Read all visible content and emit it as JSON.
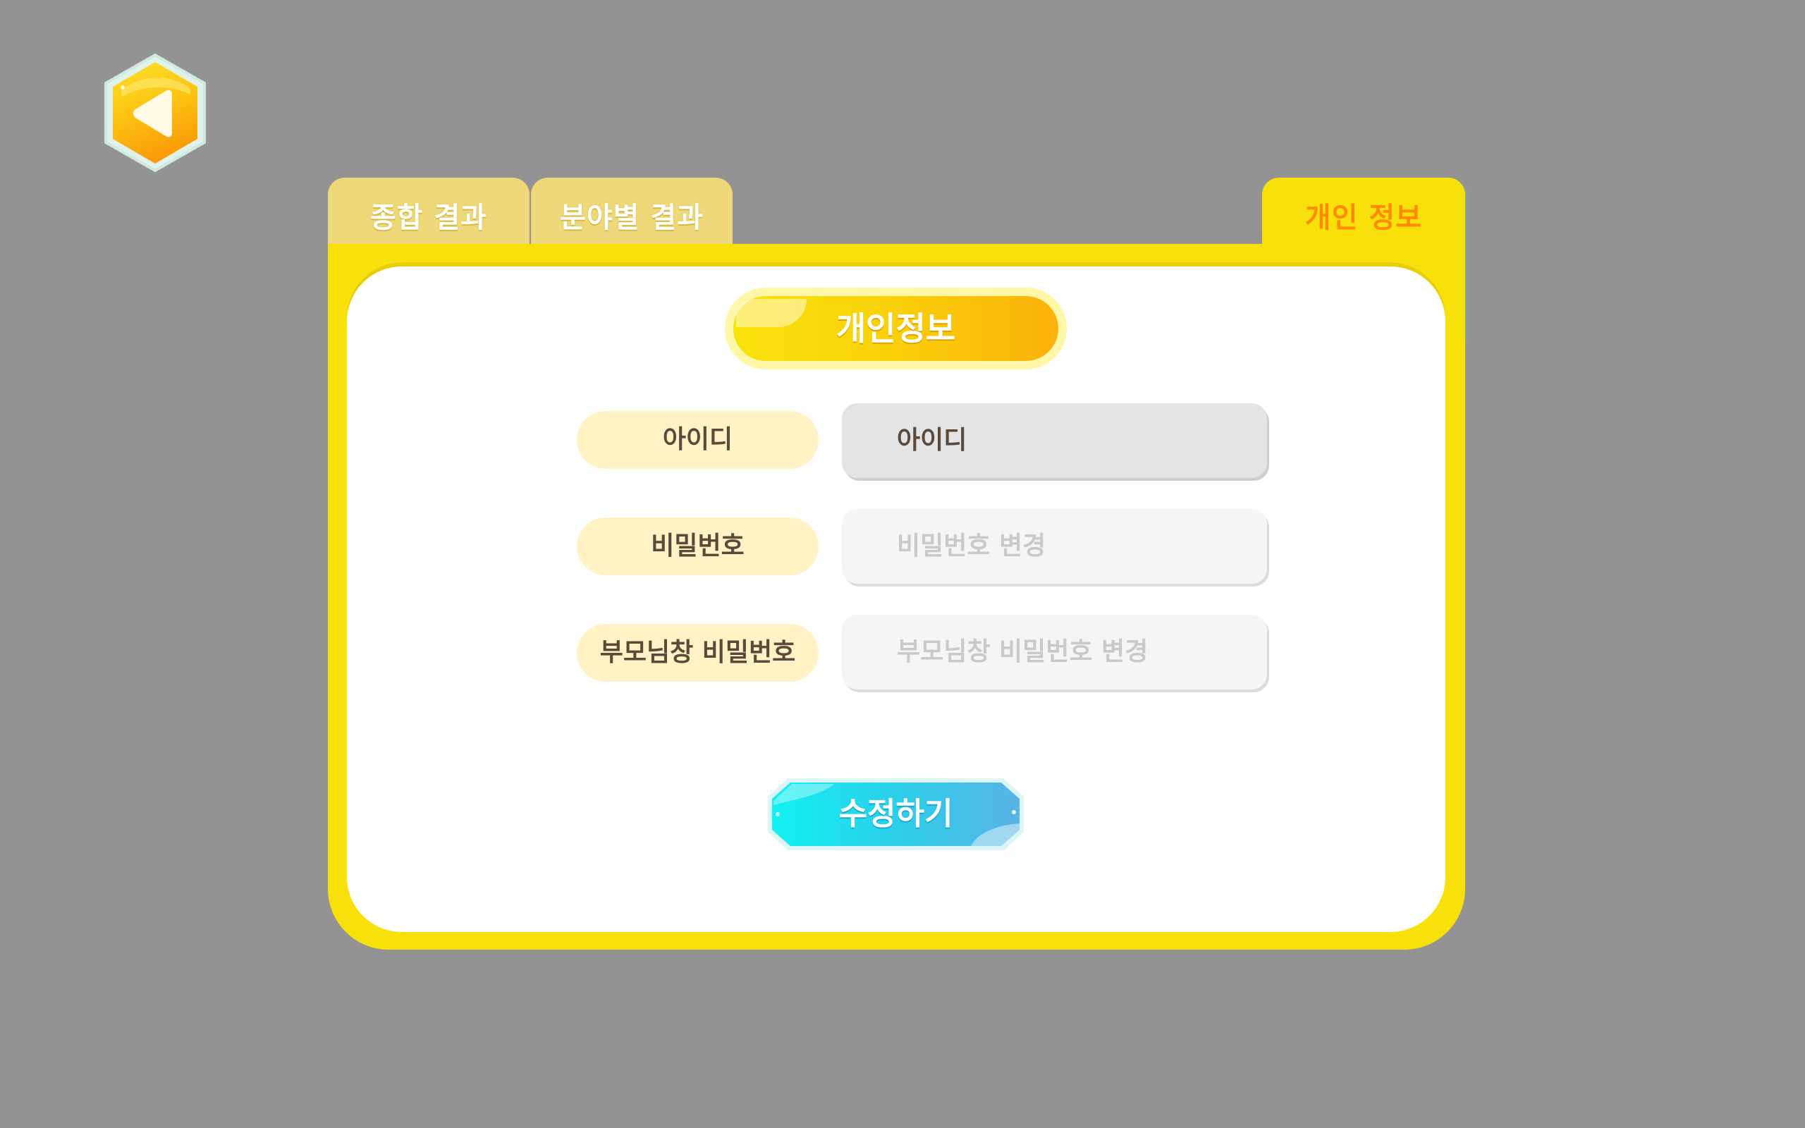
{
  "back_button": {
    "icon": "back-arrow-icon",
    "color": "#fbb10a"
  },
  "tabs": [
    {
      "label": "종합 결과",
      "active": false
    },
    {
      "label": "분야별 결과",
      "active": false
    },
    {
      "label": "개인 정보",
      "active": true
    }
  ],
  "panel": {
    "title": "개인정보",
    "fields": [
      {
        "label": "아이디",
        "value": "아이디",
        "placeholder": "",
        "editable": false
      },
      {
        "label": "비밀번호",
        "value": "",
        "placeholder": "비밀번호 변경",
        "editable": true
      },
      {
        "label": "부모님창 비밀번호",
        "value": "",
        "placeholder": "부모님창 비밀번호 변경",
        "editable": true
      }
    ],
    "submit_label": "수정하기"
  },
  "colors": {
    "background": "#939393",
    "panel_yellow": "#f8e10a",
    "active_tab_text": "#ff8a00",
    "label_pill": "#fff2c4",
    "submit_start": "#12f1f2",
    "submit_end": "#5ab3e5"
  }
}
